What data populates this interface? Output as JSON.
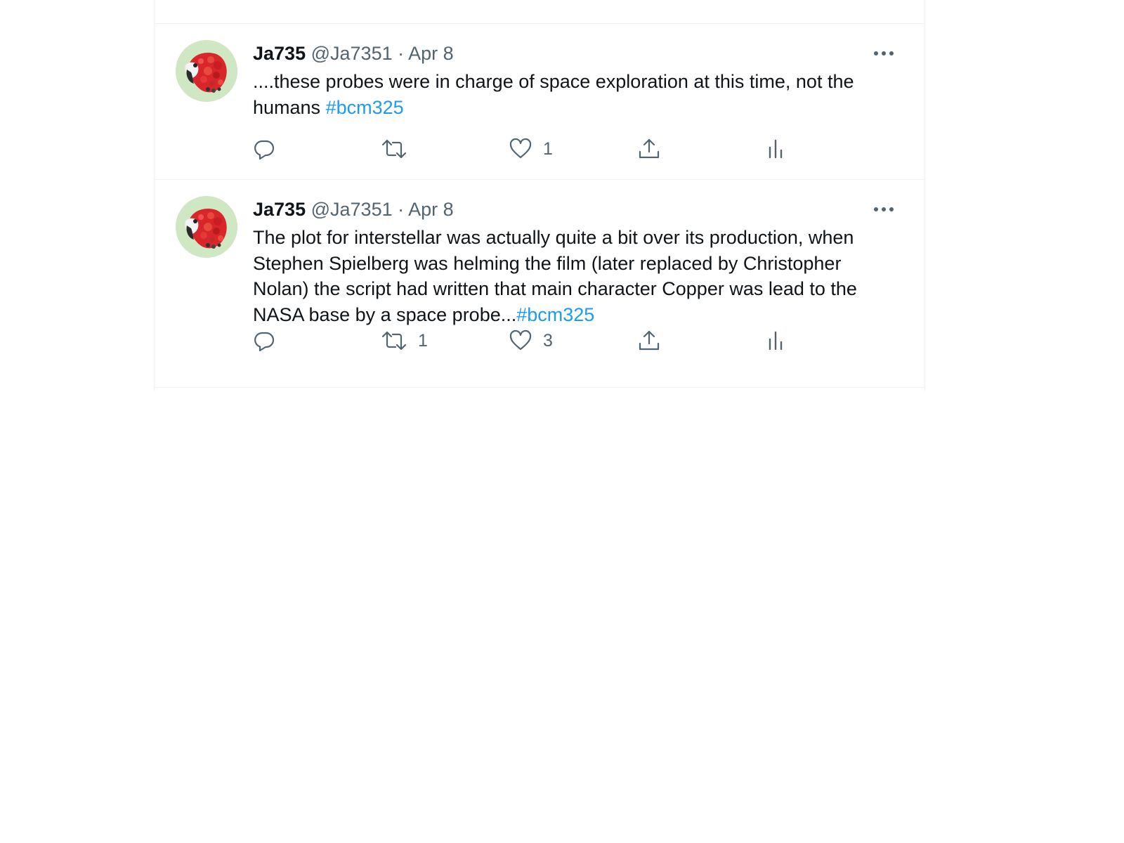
{
  "tweets": [
    {
      "display_name": "Ja735",
      "handle": "@Ja7351",
      "separator": "·",
      "date": "Apr 8",
      "text": "....these probes were in charge of space exploration at this time, not the humans ",
      "hashtag": "#bcm325",
      "counts": {
        "reply": "",
        "retweet": "",
        "like": "1"
      }
    },
    {
      "display_name": "Ja735",
      "handle": "@Ja7351",
      "separator": "·",
      "date": "Apr 8",
      "text": "The plot for interstellar was actually quite a bit over its production, when Stephen Spielberg was helming the film (later replaced by Christopher Nolan) the script had written that main character Copper was lead to the NASA base by a space probe...",
      "hashtag": "#bcm325",
      "counts": {
        "reply": "",
        "retweet": "1",
        "like": "3"
      }
    }
  ],
  "icons": {
    "more": "more-horizontal-icon",
    "reply": "reply-icon",
    "retweet": "retweet-icon",
    "like": "heart-icon",
    "share": "share-icon",
    "analytics": "analytics-icon",
    "avatar": "parrot-avatar"
  },
  "colors": {
    "text": "#0f1419",
    "secondary": "#536471",
    "hashtag": "#1d9bf0",
    "avatar_bg": "#cfe7c2",
    "divider": "#eff3f4"
  }
}
